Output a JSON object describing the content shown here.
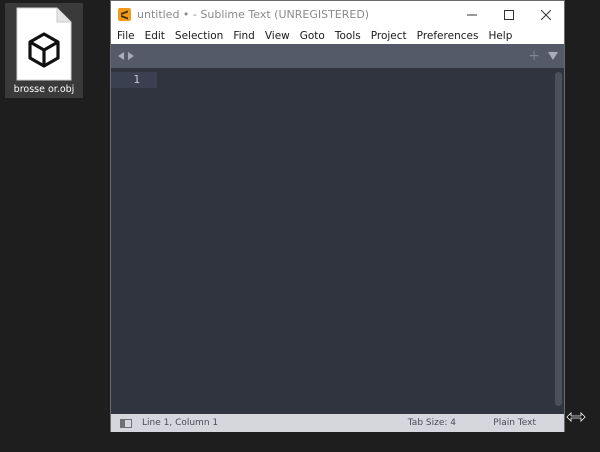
{
  "desktop": {
    "file_label": "brosse or.obj",
    "file_icon": "3d-object-file-icon"
  },
  "window": {
    "title": "untitled • - Sublime Text (UNREGISTERED)",
    "app_icon": "sublime-text-icon",
    "controls": [
      "minimize-icon",
      "maximize-icon",
      "close-icon"
    ]
  },
  "menu": {
    "items": [
      "File",
      "Edit",
      "Selection",
      "Find",
      "View",
      "Goto",
      "Tools",
      "Project",
      "Preferences",
      "Help"
    ]
  },
  "tabbar": {
    "plus": "+"
  },
  "editor": {
    "line_number": "1"
  },
  "status": {
    "position": "Line 1, Column 1",
    "tab_size": "Tab Size: 4",
    "syntax": "Plain Text"
  },
  "colors": {
    "editor_bg": "#2f343f",
    "tabbar_bg": "#545a67",
    "status_bg": "#d5d7dc",
    "accent": "#f29a1a"
  }
}
